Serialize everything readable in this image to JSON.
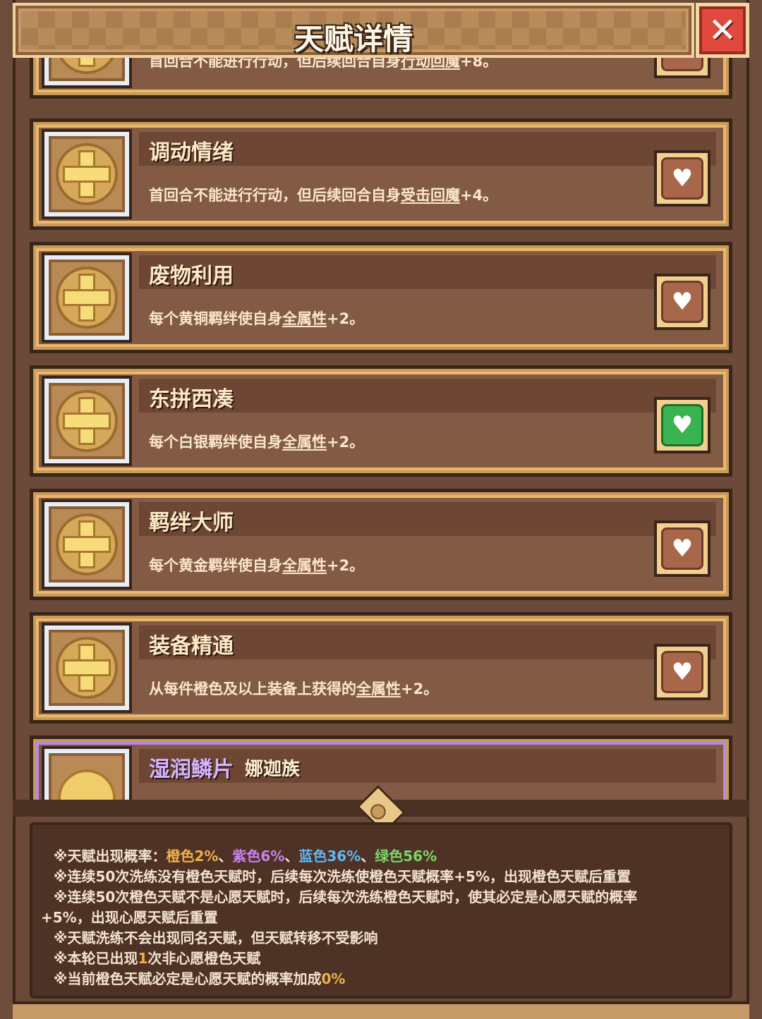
{
  "header": {
    "title": "天赋详情",
    "close_label": "✕"
  },
  "talents": [
    {
      "name": "",
      "desc_pre": "首回合不能进行行动，但后续回合自身",
      "desc_link": "行动回魔",
      "desc_post": "+8。",
      "favorited": false,
      "partial": "top"
    },
    {
      "name": "调动情绪",
      "desc_pre": "首回合不能进行行动，但后续回合自身",
      "desc_link": "受击回魔",
      "desc_post": "+4。",
      "favorited": false
    },
    {
      "name": "废物利用",
      "desc_pre": "每个黄铜羁绊使自身",
      "desc_link": "全属性",
      "desc_post": "+2。",
      "favorited": false
    },
    {
      "name": "东拼西凑",
      "desc_pre": "每个白银羁绊使自身",
      "desc_link": "全属性",
      "desc_post": "+2。",
      "favorited": true
    },
    {
      "name": "羁绊大师",
      "desc_pre": "每个黄金羁绊使自身",
      "desc_link": "全属性",
      "desc_post": "+2。",
      "favorited": false
    },
    {
      "name": "装备精通",
      "desc_pre": "从每件橙色及以上装备上获得的",
      "desc_link": "全属性",
      "desc_post": "+2。",
      "favorited": false
    },
    {
      "name": "湿润鳞片",
      "tag": "娜迦族",
      "desc_pre": "",
      "desc_link": "",
      "desc_post": "",
      "favorited": false,
      "partial": "bottom"
    }
  ],
  "info": {
    "prob_prefix": "※天赋出现概率：",
    "orange": "橙色2%",
    "sep1": "、",
    "purple": "紫色6%",
    "sep2": "、",
    "blue": "蓝色36%",
    "sep3": "、",
    "green": "绿色56%",
    "line2": "※连续50次洗练没有橙色天赋时，后续每次洗练使橙色天赋概率+5%，出现橙色天赋后重置",
    "line3": "※连续50次橙色天赋不是心愿天赋时，后续每次洗练橙色天赋时，使其必定是心愿天赋的概率",
    "line4": "+5%，出现心愿天赋后重置",
    "line5": "※天赋洗练不会出现同名天赋，但天赋转移不受影响",
    "line6_pre": "※本轮已出现",
    "line6_num": "1",
    "line6_post": "次非心愿橙色天赋",
    "line7_pre": "※当前橙色天赋必定是心愿天赋的概率加成",
    "line7_num": "0%"
  },
  "colors": {
    "orange": "#f0b04a",
    "purple": "#c782ef",
    "blue": "#5fb7f2",
    "green": "#79d66a",
    "favorite_active": "#38b350"
  }
}
